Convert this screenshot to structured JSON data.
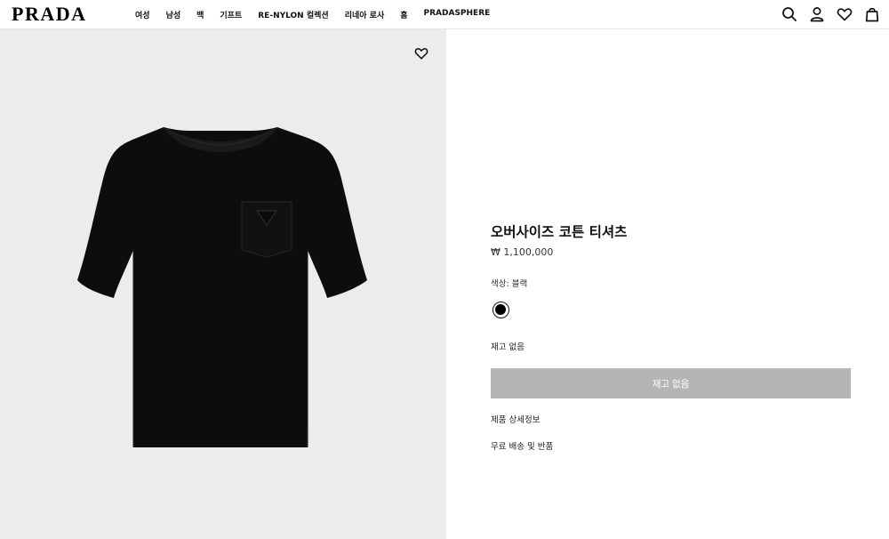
{
  "header": {
    "logo": "PRADA",
    "nav": [
      "여성",
      "남성",
      "백",
      "기프트",
      "RE-NYLON 컬렉션",
      "리네아 로사",
      "홈",
      "PRADASPHERE"
    ],
    "icons": [
      "search-icon",
      "account-icon",
      "wishlist-icon",
      "bag-icon"
    ]
  },
  "product": {
    "title": "오버사이즈 코튼 티셔츠",
    "price": "₩ 1,100,000",
    "color_label": "색상:",
    "color_value": "블랙",
    "swatch_color": "#000000",
    "stock_status": "재고 없음",
    "button_label": "재고 없음",
    "details_link": "제품 상세정보",
    "shipping_link": "무료 배송 및 반품"
  },
  "colors": {
    "image_bg": "#ececec",
    "button_bg": "#b5b5b5"
  }
}
